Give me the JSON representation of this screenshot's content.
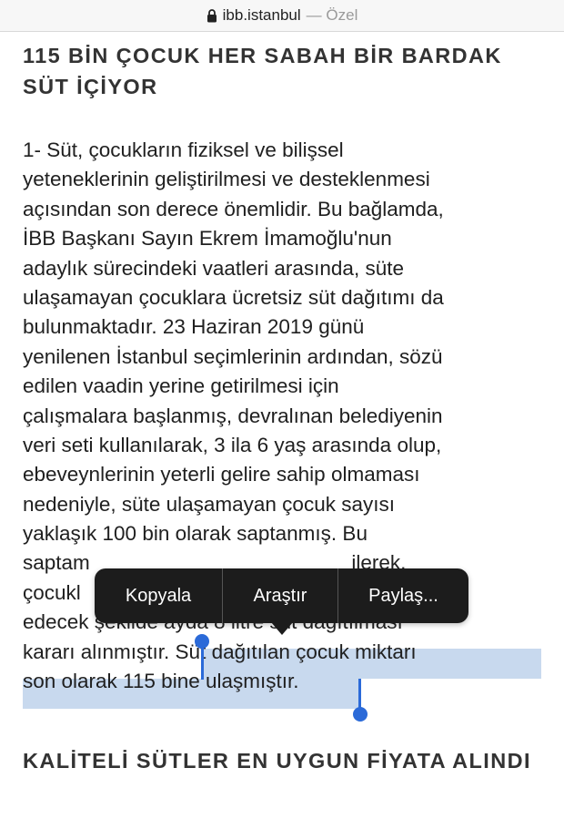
{
  "browser": {
    "domain": "ibb.istanbul",
    "separator": "—",
    "mode": "Özel"
  },
  "article": {
    "heading1": "115 BİN ÇOCUK HER SABAH BİR BARDAK SÜT İÇİYOR",
    "heading2": "KALİTELİ SÜTLER EN UYGUN FİYATA ALINDI",
    "lines": [
      "1- Süt, çocukların fiziksel ve bilişsel",
      "yeteneklerinin geliştirilmesi ve desteklenmesi",
      "açısından son derece önemlidir. Bu bağlamda,",
      "İBB Başkanı Sayın Ekrem İmamoğlu'nun",
      "adaylık sürecindeki vaatleri arasında, süte",
      "ulaşamayan çocuklara ücretsiz süt dağıtımı da",
      "bulunmaktadır. 23 Haziran 2019 günü",
      "yenilenen İstanbul seçimlerinin ardından, sözü",
      "edilen vaadin yerine getirilmesi için",
      "çalışmalara başlanmış, devralınan belediyenin",
      "veri seti kullanılarak, 3 ila 6 yaş arasında olup,",
      "ebeveynlerinin yeterli gelire sahip olmaması",
      "nedeniyle, süte ulaşamayan çocuk sayısı",
      "yaklaşık 100 bin olarak saptanmış. Bu",
      "saptam                                              ilerek,",
      "çocukl                                              kabül",
      "edecek şekilde ayda 8 litre süt dağıtılması"
    ],
    "line18_plain": "kararı alınmıştır. ",
    "line18_selected": "Süt dağıtılan çocuk miktarı",
    "line19_selected": "son olarak 115 bine ulaşmıştır."
  },
  "context_menu": {
    "copy": "Kopyala",
    "lookup": "Araştır",
    "share": "Paylaş..."
  },
  "colors": {
    "selection": "#c8d9ee",
    "handle": "#2b6ad8",
    "menu_bg": "#1c1c1c"
  }
}
